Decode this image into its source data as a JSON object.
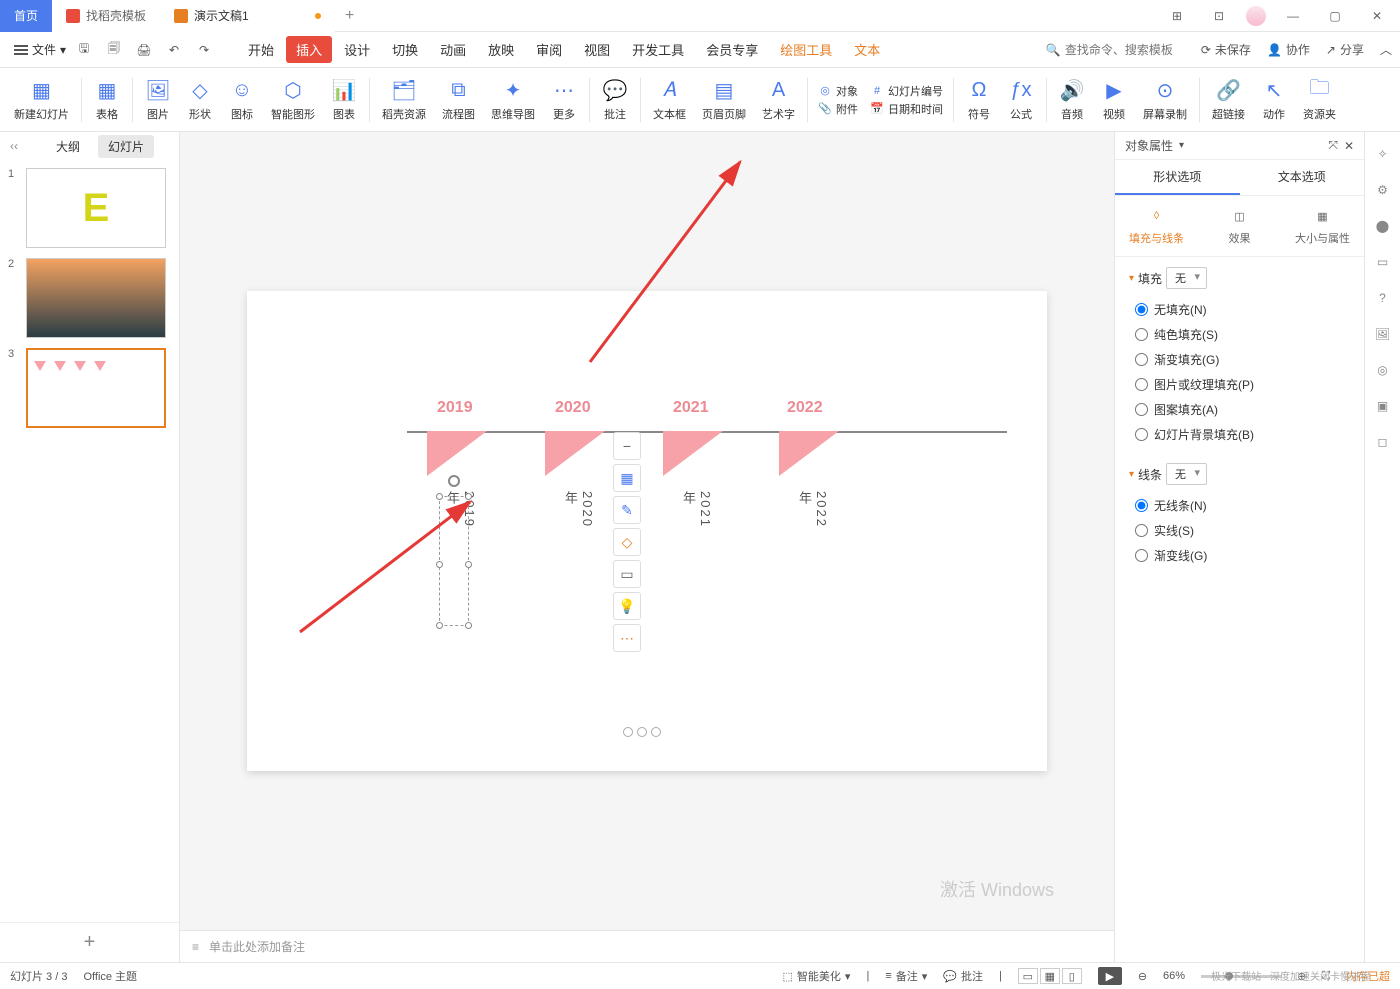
{
  "titlebar": {
    "tab_home": "首页",
    "tab_template": "找稻壳模板",
    "tab_doc": "演示文稿1",
    "add": "+"
  },
  "window_icons": {
    "layout": "⊞",
    "apps": "⊡"
  },
  "file_menu": "文件",
  "menu_tabs": [
    "开始",
    "插入",
    "设计",
    "切换",
    "动画",
    "放映",
    "审阅",
    "视图",
    "开发工具",
    "会员专享",
    "绘图工具",
    "文本"
  ],
  "menu_right": {
    "search_placeholder": "查找命令、搜索模板",
    "unsaved": "未保存",
    "collab": "协作",
    "share": "分享"
  },
  "ribbon": {
    "new_slide": "新建幻灯片",
    "table": "表格",
    "picture": "图片",
    "shape": "形状",
    "icon": "图标",
    "smart": "智能图形",
    "chart": "图表",
    "docer": "稻壳资源",
    "flowchart": "流程图",
    "mindmap": "思维导图",
    "more": "更多",
    "comment": "批注",
    "textbox": "文本框",
    "header": "页眉页脚",
    "wordart": "艺术字",
    "object": "对象",
    "attachment": "附件",
    "slidenum": "幻灯片编号",
    "datetime": "日期和时间",
    "symbol": "符号",
    "equation": "公式",
    "audio": "音频",
    "video": "视频",
    "record": "屏幕录制",
    "hyperlink": "超链接",
    "action": "动作",
    "resource": "资源夹"
  },
  "left": {
    "outline": "大纲",
    "slides": "幻灯片",
    "n1": "1",
    "n2": "2",
    "n3": "3",
    "e": "E"
  },
  "slide": {
    "y2019": "2019",
    "y2020": "2020",
    "y2021": "2021",
    "y2022": "2022",
    "t2019": "2019年",
    "t2020": "2020年",
    "t2021": "2021年",
    "t2022": "2022年"
  },
  "float_tools": [
    "−",
    "▦",
    "✎",
    "◇",
    "▭",
    "💡",
    "⋯"
  ],
  "notes": "单击此处添加备注",
  "props": {
    "title": "对象属性",
    "tab_shape": "形状选项",
    "tab_text": "文本选项",
    "sub_fill": "填充与线条",
    "sub_effect": "效果",
    "sub_size": "大小与属性",
    "section_fill": "填充",
    "section_line": "线条",
    "none": "无",
    "fill_none": "无填充(N)",
    "fill_solid": "纯色填充(S)",
    "fill_gradient": "渐变填充(G)",
    "fill_picture": "图片或纹理填充(P)",
    "fill_pattern": "图案填充(A)",
    "fill_bg": "幻灯片背景填充(B)",
    "line_none": "无线条(N)",
    "line_solid": "实线(S)",
    "line_gradient": "渐变线(G)"
  },
  "status": {
    "slide_pos": "幻灯片 3 / 3",
    "theme": "Office 主题",
    "beautify": "智能美化",
    "notes": "备注",
    "comment": "批注",
    "zoom": "66%",
    "mem": "内存已超"
  },
  "watermark": "激活 Windows",
  "watermark2": "深度加速关闭卡慢进程",
  "logo_text": "极光下载站"
}
